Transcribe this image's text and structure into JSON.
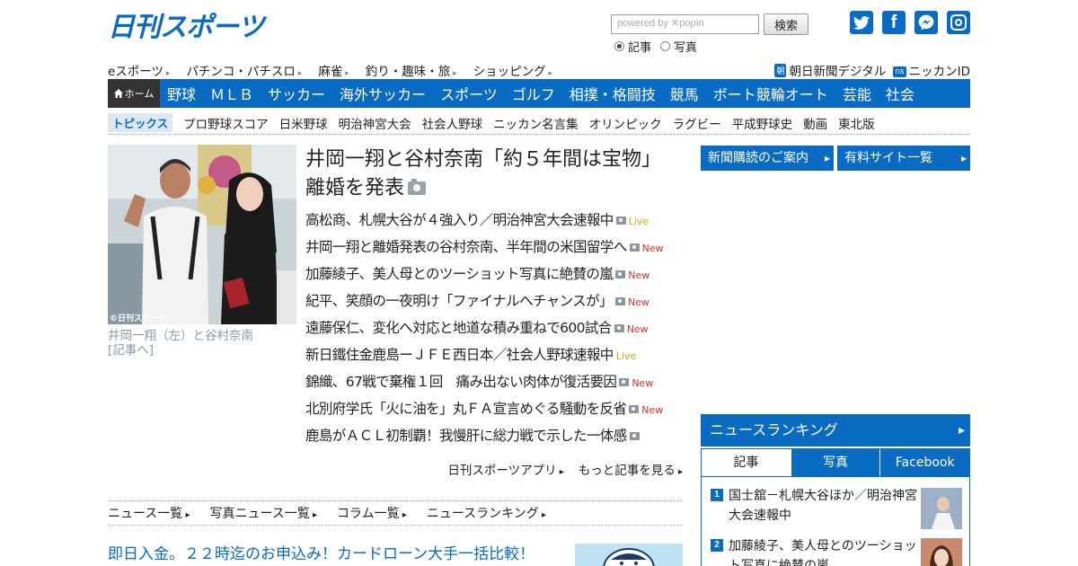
{
  "header": {
    "logo_text": "日刊スポーツ",
    "search_placeholder": "powered by ✕popIn",
    "search_button": "検索",
    "radio_articles": "記事",
    "radio_photos": "写真",
    "social": {
      "twitter": "t",
      "facebook": "f",
      "messenger": "m"
    }
  },
  "sublinks": [
    "eスポーツ",
    "パチンコ・パチスロ",
    "麻雀",
    "釣り・趣味・旅",
    "ショッピング"
  ],
  "extlinks": [
    {
      "badge": "朝",
      "label": "朝日新聞デジタル"
    },
    {
      "badge": "ns",
      "label": "ニッカンID"
    }
  ],
  "mainnav": {
    "home": "ホーム",
    "items": [
      "野球",
      "ＭＬＢ",
      "サッカー",
      "海外サッカー",
      "スポーツ",
      "ゴルフ",
      "相撲・格闘技",
      "競馬",
      "ボート競輪オート",
      "芸能",
      "社会"
    ]
  },
  "topics": {
    "label": "トピックス",
    "items": [
      "プロ野球スコア",
      "日米野球",
      "明治神宮大会",
      "社会人野球",
      "ニッカン名言集",
      "オリンピック",
      "ラグビー",
      "平成野球史",
      "動画",
      "東北版"
    ]
  },
  "feature": {
    "photo_credit": "©日刊スポーツ",
    "caption_line1": "井岡一翔（左）と谷村奈南",
    "caption_line2": "[記事へ]",
    "headline_line1": "井岡一翔と谷村奈南「約５年間は宝物」",
    "headline_line2": "離婚を発表"
  },
  "news": [
    {
      "text": "高松商、札幌大谷が４強入り／明治神宮大会速報中",
      "tag": "Live"
    },
    {
      "text": "井岡一翔と離婚発表の谷村奈南、半年間の米国留学へ",
      "tag": "New"
    },
    {
      "text": "加藤綾子、美人母とのツーショット写真に絶賛の嵐",
      "tag": "New"
    },
    {
      "text": "紀平、笑顔の一夜明け「ファイナルへチャンスが」",
      "tag": "New"
    },
    {
      "text": "遠藤保仁、変化へ対応と地道な積み重ねで600試合",
      "tag": "New"
    },
    {
      "text": "新日鐵住金鹿島ーＪＦＥ西日本／社会人野球速報中",
      "tag": "Live"
    },
    {
      "text": "錦織、67戦で棄権１回　痛み出ない肉体が復活要因",
      "tag": "New"
    },
    {
      "text": "北別府学氏「火に油を」丸ＦＡ宣言めぐる騒動を反省",
      "tag": "New"
    },
    {
      "text": "鹿島がＡＣＬ初制覇！我慢肝に総力戦で示した一体感",
      "tag": ""
    }
  ],
  "more_links": [
    "日刊スポーツアプリ",
    "もっと記事を見る"
  ],
  "list_links": [
    "ニュース一覧",
    "写真ニュース一覧",
    "コラム一覧",
    "ニュースランキング"
  ],
  "ad_text": "即日入金。２２時迄のお申込み！カードローン大手一括比較！",
  "right": {
    "btn1": "新聞購読のご案内",
    "btn2": "有料サイト一覧",
    "ranking_title": "ニュースランキング",
    "tabs": [
      "記事",
      "写真",
      "Facebook"
    ],
    "ranking": [
      {
        "num": "1",
        "text": "国士舘－札幌大谷ほか／明治神宮大会速報中"
      },
      {
        "num": "2",
        "text": "加藤綾子、美人母とのツーショット写真に絶賛の嵐"
      }
    ]
  },
  "colors": {
    "brand": "#0a6bc2",
    "live": "#d4a617",
    "new": "#d4322c"
  }
}
